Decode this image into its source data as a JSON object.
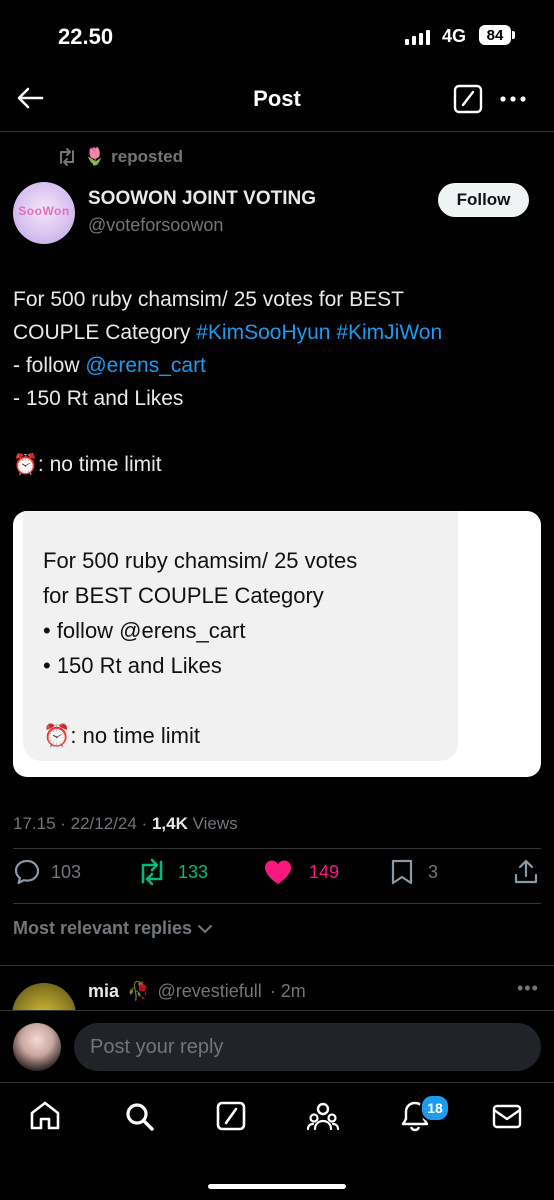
{
  "status_bar": {
    "time": "22.50",
    "network": "4G",
    "battery": "84"
  },
  "header": {
    "title": "Post"
  },
  "repost": {
    "emoji": "🌷",
    "label": "reposted"
  },
  "author": {
    "display_name": "SOOWON JOINT VOTING",
    "handle": "@voteforsoowon",
    "avatar_text": "SooWon",
    "follow_label": "Follow"
  },
  "post": {
    "line1": "For 500 ruby chamsim/ 25 votes for  BEST",
    "line2_prefix": "COUPLE Category ",
    "hashtag1": "#KimSooHyun",
    "hashtag2": "#KimJiWon",
    "line3_prefix": "- follow ",
    "mention": "@erens_cart",
    "line4": "- 150 Rt and Likes",
    "alarm_emoji": "⏰",
    "line5": ": no time limit"
  },
  "image_card": {
    "line1": "For 500 ruby chamsim/ 25 votes",
    "line2": "for  BEST COUPLE Category",
    "line3": "• follow @erens_cart",
    "line4": "• 150 Rt and Likes",
    "alarm_emoji": "⏰",
    "line5": ": no time limit"
  },
  "meta": {
    "time_date": "17.15 · 22/12/24 · ",
    "views_count": "1,4K",
    "views_label": " Views"
  },
  "actions": {
    "replies": "103",
    "reposts": "133",
    "likes": "149",
    "bookmarks": "3"
  },
  "replies_section": {
    "label": "Most relevant replies"
  },
  "reply_preview": {
    "name": "mia",
    "emoji": "🥀",
    "handle": "@revestiefull",
    "time": "· 2m",
    "more": "•••"
  },
  "composer": {
    "placeholder": "Post your reply"
  },
  "nav": {
    "notification_count": "18"
  },
  "colors": {
    "accent": "#1d9bf0",
    "repost_green": "#00ba7c",
    "like_pink": "#f91880",
    "muted": "#71767b"
  }
}
